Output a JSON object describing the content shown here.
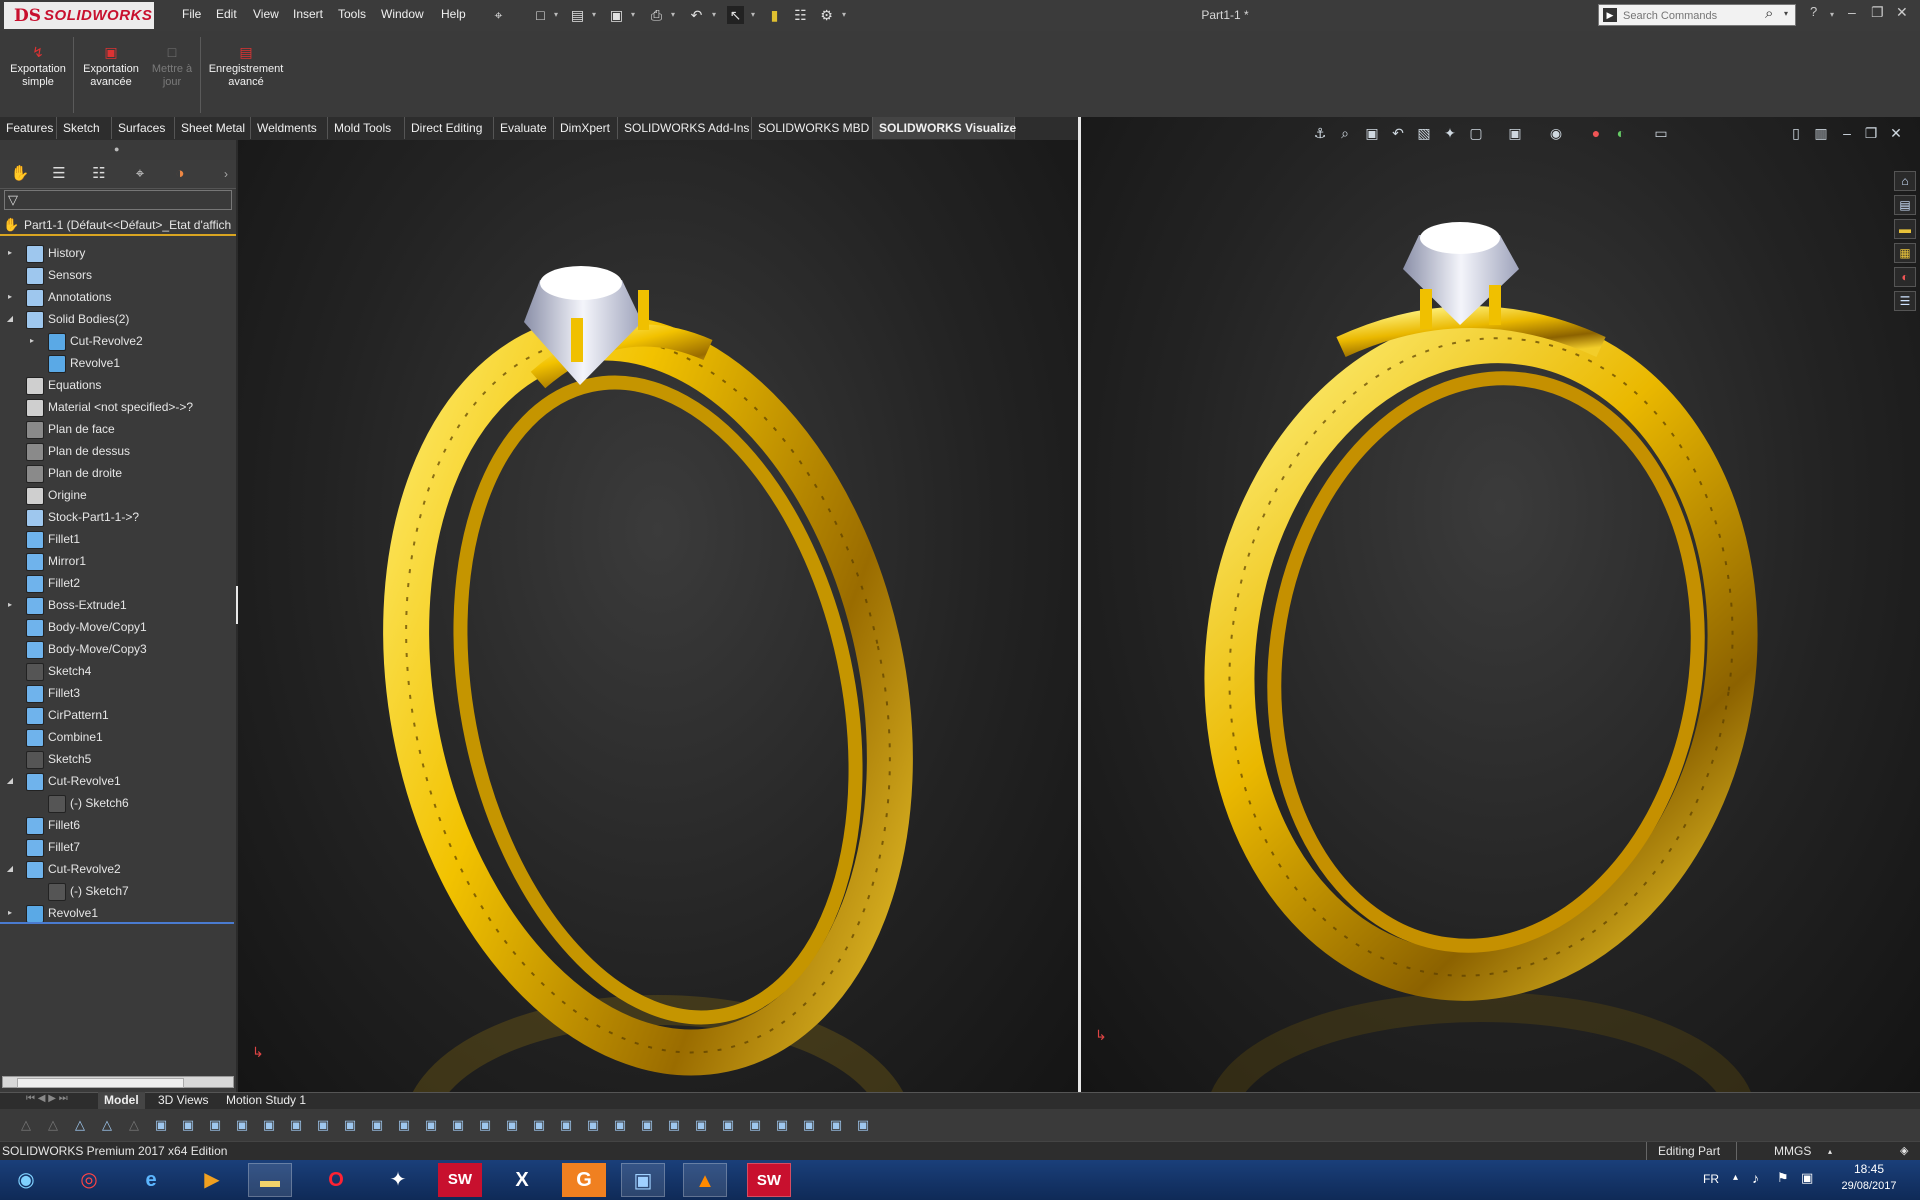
{
  "app": {
    "logo_prefix": "DS",
    "logo_name": "SOLIDWORKS",
    "document_title": "Part1-1 *",
    "menu": [
      "File",
      "Edit",
      "View",
      "Insert",
      "Tools",
      "Window",
      "Help"
    ],
    "search_placeholder": "Search Commands",
    "help_icon": "?"
  },
  "command_manager": {
    "buttons": [
      {
        "label": "Exportation\nsimple",
        "enabled": true
      },
      {
        "label": "Exportation\navancée",
        "enabled": true
      },
      {
        "label": "Mettre à\njour",
        "enabled": false
      },
      {
        "label": "Enregistrement\navancé",
        "enabled": true
      }
    ]
  },
  "tabs": [
    "Features",
    "Sketch",
    "Surfaces",
    "Sheet Metal",
    "Weldments",
    "Mold Tools",
    "Direct Editing",
    "Evaluate",
    "DimXpert",
    "SOLIDWORKS Add-Ins",
    "SOLIDWORKS MBD",
    "SOLIDWORKS Visualize"
  ],
  "active_tab": "SOLIDWORKS Visualize",
  "feature_tree": {
    "root": "Part1-1  (Défaut<<Défaut>_Etat d'affich",
    "items": [
      {
        "label": "History",
        "icon": "history-icon",
        "expander": "right",
        "indent": 0
      },
      {
        "label": "Sensors",
        "icon": "sensor-icon",
        "expander": "",
        "indent": 0
      },
      {
        "label": "Annotations",
        "icon": "annotations-icon",
        "expander": "right",
        "indent": 0
      },
      {
        "label": "Solid Bodies(2)",
        "icon": "solid-bodies-icon",
        "expander": "down",
        "indent": 0
      },
      {
        "label": "Cut-Revolve2",
        "icon": "body-icon",
        "expander": "right",
        "indent": 1
      },
      {
        "label": "Revolve1",
        "icon": "body-icon",
        "expander": "",
        "indent": 1
      },
      {
        "label": "Equations",
        "icon": "equations-icon",
        "expander": "",
        "indent": 0
      },
      {
        "label": "Material <not specified>->?",
        "icon": "material-icon",
        "expander": "",
        "indent": 0
      },
      {
        "label": "Plan de face",
        "icon": "plane-icon",
        "expander": "",
        "indent": 0
      },
      {
        "label": "Plan de dessus",
        "icon": "plane-icon",
        "expander": "",
        "indent": 0
      },
      {
        "label": "Plan de droite",
        "icon": "plane-icon",
        "expander": "",
        "indent": 0
      },
      {
        "label": "Origine",
        "icon": "origin-icon",
        "expander": "",
        "indent": 0
      },
      {
        "label": "Stock-Part1-1->?",
        "icon": "stock-icon",
        "expander": "",
        "indent": 0
      },
      {
        "label": "Fillet1",
        "icon": "fillet-icon",
        "expander": "",
        "indent": 0
      },
      {
        "label": "Mirror1",
        "icon": "mirror-icon",
        "expander": "",
        "indent": 0
      },
      {
        "label": "Fillet2",
        "icon": "fillet-icon",
        "expander": "",
        "indent": 0
      },
      {
        "label": "Boss-Extrude1",
        "icon": "extrude-icon",
        "expander": "right",
        "indent": 0
      },
      {
        "label": "Body-Move/Copy1",
        "icon": "move-copy-icon",
        "expander": "",
        "indent": 0
      },
      {
        "label": "Body-Move/Copy3",
        "icon": "move-copy-icon",
        "expander": "",
        "indent": 0
      },
      {
        "label": "Sketch4",
        "icon": "sketch-icon",
        "expander": "",
        "indent": 0
      },
      {
        "label": "Fillet3",
        "icon": "fillet-icon",
        "expander": "",
        "indent": 0
      },
      {
        "label": "CirPattern1",
        "icon": "circular-pattern-icon",
        "expander": "",
        "indent": 0
      },
      {
        "label": "Combine1",
        "icon": "combine-icon",
        "expander": "",
        "indent": 0
      },
      {
        "label": "Sketch5",
        "icon": "sketch-icon",
        "expander": "",
        "indent": 0
      },
      {
        "label": "Cut-Revolve1",
        "icon": "cut-revolve-icon",
        "expander": "down",
        "indent": 0
      },
      {
        "label": "(-) Sketch6",
        "icon": "sketch-icon",
        "expander": "",
        "indent": 1
      },
      {
        "label": "Fillet6",
        "icon": "fillet-icon",
        "expander": "",
        "indent": 0
      },
      {
        "label": "Fillet7",
        "icon": "fillet-icon",
        "expander": "",
        "indent": 0
      },
      {
        "label": "Cut-Revolve2",
        "icon": "cut-revolve-icon",
        "expander": "down",
        "indent": 0
      },
      {
        "label": "(-) Sketch7",
        "icon": "sketch-icon",
        "expander": "",
        "indent": 1
      },
      {
        "label": "Revolve1",
        "icon": "revolve-icon",
        "expander": "right",
        "indent": 0
      }
    ]
  },
  "bottom_tabs": [
    "Model",
    "3D Views",
    "Motion Study 1"
  ],
  "active_bottom_tab": "Model",
  "status": {
    "left": "SOLIDWORKS Premium 2017 x64 Edition",
    "mode": "Editing Part",
    "units": "MMGS"
  },
  "taskbar": {
    "language": "FR",
    "time": "18:45",
    "date": "29/08/2017"
  },
  "colors": {
    "gold": "#f2c200",
    "brand_red": "#c8102e",
    "accent_underline": "#d9a521"
  }
}
